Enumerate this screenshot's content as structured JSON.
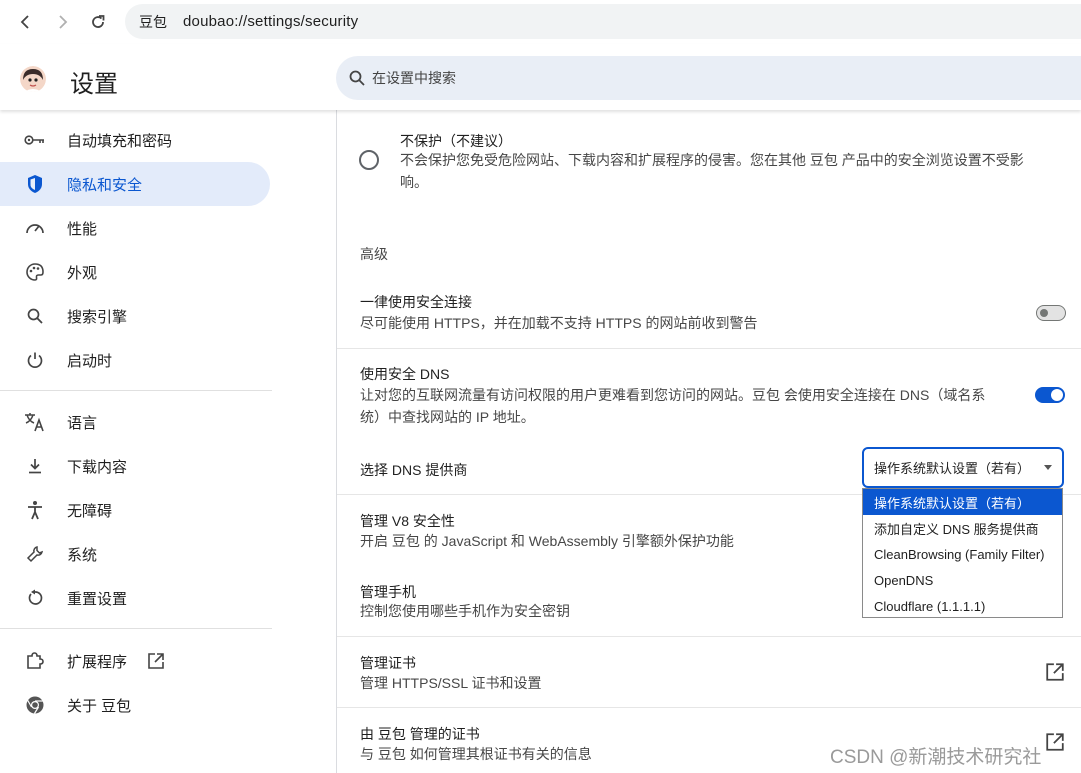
{
  "browser": {
    "site_name": "豆包",
    "url": "doubao://settings/security"
  },
  "header": {
    "title": "设置",
    "search_placeholder": "在设置中搜索"
  },
  "sidebar": {
    "items": [
      {
        "label": "自动填充和密码",
        "icon": "key-icon"
      },
      {
        "label": "隐私和安全",
        "icon": "shield-icon",
        "active": true
      },
      {
        "label": "性能",
        "icon": "speedometer-icon"
      },
      {
        "label": "外观",
        "icon": "palette-icon"
      },
      {
        "label": "搜索引擎",
        "icon": "search-icon"
      },
      {
        "label": "启动时",
        "icon": "power-icon"
      },
      {
        "label": "语言",
        "icon": "translate-icon"
      },
      {
        "label": "下载内容",
        "icon": "download-icon"
      },
      {
        "label": "无障碍",
        "icon": "accessibility-icon"
      },
      {
        "label": "系统",
        "icon": "wrench-icon"
      },
      {
        "label": "重置设置",
        "icon": "reset-icon"
      },
      {
        "label": "扩展程序",
        "icon": "puzzle-icon"
      },
      {
        "label": "关于 豆包",
        "icon": "browser-logo-icon"
      }
    ]
  },
  "content": {
    "no_protection": {
      "title": "不保护（不建议）",
      "desc_line1": "不会保护您免受危险网站、下载内容和扩展程序的侵害。您在其他 豆包 产品中的安全浏览设置不受影",
      "desc_line2": "响。"
    },
    "advanced_heading": "高级",
    "https_only": {
      "title": "一律使用安全连接",
      "desc": "尽可能使用 HTTPS，并在加载不支持 HTTPS 的网站前收到警告",
      "enabled": false
    },
    "secure_dns": {
      "title": "使用安全 DNS",
      "desc_line1": "让对您的互联网流量有访问权限的用户更难看到您访问的网站。豆包 会使用安全连接在 DNS（域名系",
      "desc_line2": "统）中查找网站的 IP 地址。",
      "enabled": true,
      "provider_label": "选择 DNS 提供商",
      "selected": "操作系统默认设置（若有）",
      "options": [
        "操作系统默认设置（若有）",
        "添加自定义 DNS 服务提供商",
        "CleanBrowsing (Family Filter)",
        "OpenDNS",
        "Cloudflare (1.1.1.1)"
      ]
    },
    "v8": {
      "title": "管理 V8 安全性",
      "desc": "开启 豆包 的 JavaScript 和 WebAssembly 引擎额外保护功能"
    },
    "phones": {
      "title": "管理手机",
      "desc": "控制您使用哪些手机作为安全密钥"
    },
    "certs": {
      "title": "管理证书",
      "desc": "管理 HTTPS/SSL 证书和设置"
    },
    "managed_certs": {
      "title": "由 豆包 管理的证书",
      "desc": "与 豆包 如何管理其根证书有关的信息"
    }
  },
  "watermark": "CSDN @新潮技术研究社",
  "colors": {
    "accent": "#0b57d0",
    "active_bg": "#e3ebfa"
  }
}
